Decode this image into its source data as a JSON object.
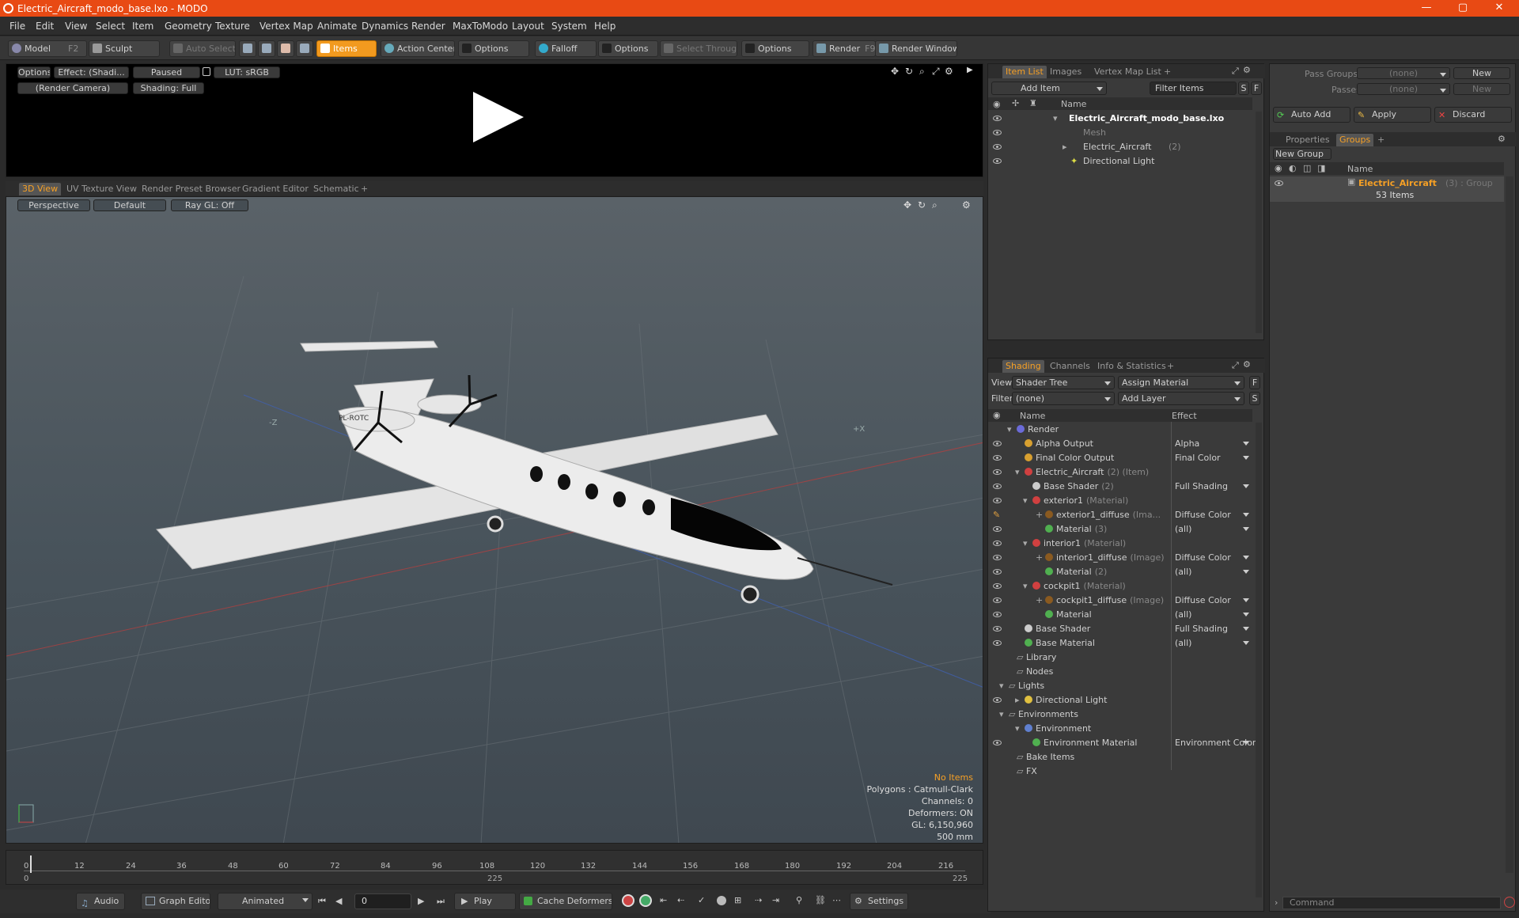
{
  "window": {
    "title": "Electric_Aircraft_modo_base.lxo - MODO",
    "controls": [
      "—",
      "▢",
      "✕"
    ]
  },
  "menu": [
    "File",
    "Edit",
    "View",
    "Select",
    "Item",
    "Geometry",
    "Texture",
    "Vertex Map",
    "Animate",
    "Dynamics",
    "Render",
    "MaxToModo",
    "Layout",
    "System",
    "Help"
  ],
  "toolbar": {
    "model": "Model",
    "model_key": "F2",
    "sculpt": "Sculpt",
    "auto_select": "Auto Select",
    "items": "Items",
    "action_center": "Action Center",
    "options1": "Options",
    "falloff": "Falloff",
    "options2": "Options",
    "select_through": "Select Through",
    "options3": "Options",
    "render": "Render",
    "render_key": "F9",
    "render_window": "Render Window"
  },
  "render_preview": {
    "options": "Options",
    "effect": "Effect: (Shadi...",
    "paused": "Paused",
    "lut": "LUT: sRGB",
    "camera": "(Render Camera)",
    "shading": "Shading: Full"
  },
  "view_tabs": [
    "3D View",
    "UV Texture View",
    "Render Preset Browser",
    "Gradient Editor",
    "Schematic",
    "+"
  ],
  "viewport": {
    "perspective": "Perspective",
    "default": "Default",
    "raygl": "Ray GL: Off",
    "info": {
      "items": "No Items",
      "polygons": "Polygons : Catmull-Clark",
      "channels": "Channels: 0",
      "deformers": "Deformers: ON",
      "gl": "GL: 6,150,960",
      "scale": "500 mm"
    },
    "axis_labels": {
      "neg_z": "-Z",
      "pos_x": "+X"
    },
    "tail_reg": "PL-ROTC"
  },
  "timeline": {
    "ticks": [
      "0",
      "12",
      "24",
      "36",
      "48",
      "60",
      "72",
      "84",
      "96",
      "108",
      "120",
      "132",
      "144",
      "156",
      "168",
      "180",
      "192",
      "204",
      "216"
    ],
    "start": "0",
    "mid": "225",
    "end": "225"
  },
  "bottom": {
    "audio": "Audio",
    "graph_editor": "Graph Editor",
    "animated": "Animated",
    "frame": "0",
    "play": "Play",
    "cache_deformers": "Cache Deformers",
    "settings": "Settings"
  },
  "item_list": {
    "tabs": [
      "Item List",
      "Images",
      "Vertex Map List",
      "+"
    ],
    "add_item": "Add Item",
    "filter": "Filter Items",
    "s": "S",
    "f": "F",
    "col_name": "Name",
    "rows": [
      {
        "label": "Electric_Aircraft_modo_base.lxo",
        "bold": true
      },
      {
        "label": "Mesh",
        "dim": true
      },
      {
        "label": "Electric_Aircraft",
        "suffix": "(2)"
      },
      {
        "label": "Directional Light"
      }
    ]
  },
  "shading": {
    "tabs": [
      "Shading",
      "Channels",
      "Info & Statistics",
      "+"
    ],
    "view_label": "View",
    "view_value": "Shader Tree",
    "assign_material": "Assign Material",
    "filter_label": "Filter",
    "filter_value": "(none)",
    "add_layer": "Add Layer",
    "f": "F",
    "s": "S",
    "col_name": "Name",
    "col_effect": "Effect",
    "rows": [
      {
        "label": "Render",
        "suffix": "",
        "effect": "",
        "color": "#6b6bd8"
      },
      {
        "label": "Alpha Output",
        "suffix": "",
        "effect": "Alpha",
        "color": "#d8a030"
      },
      {
        "label": "Final Color Output",
        "suffix": "",
        "effect": "Final Color",
        "color": "#d8a030"
      },
      {
        "label": "Electric_Aircraft",
        "suffix": "(2) (Item)",
        "effect": "",
        "color": "#d04040"
      },
      {
        "label": "Base Shader",
        "suffix": "(2)",
        "effect": "Full Shading",
        "color": "#cccccc"
      },
      {
        "label": "exterior1",
        "suffix": "(Material)",
        "effect": "",
        "color": "#d04040"
      },
      {
        "label": "exterior1_diffuse",
        "suffix": "(Ima...",
        "effect": "Diffuse Color",
        "color": "#8a5a20"
      },
      {
        "label": "Material",
        "suffix": "(3)",
        "effect": "(all)",
        "color": "#50b050"
      },
      {
        "label": "interior1",
        "suffix": "(Material)",
        "effect": "",
        "color": "#d04040"
      },
      {
        "label": "interior1_diffuse",
        "suffix": "(Image)",
        "effect": "Diffuse Color",
        "color": "#8a5a20"
      },
      {
        "label": "Material",
        "suffix": "(2)",
        "effect": "(all)",
        "color": "#50b050"
      },
      {
        "label": "cockpit1",
        "suffix": "(Material)",
        "effect": "",
        "color": "#d04040"
      },
      {
        "label": "cockpit1_diffuse",
        "suffix": "(Image)",
        "effect": "Diffuse Color",
        "color": "#8a5a20"
      },
      {
        "label": "Material",
        "suffix": "",
        "effect": "(all)",
        "color": "#50b050"
      },
      {
        "label": "Base Shader",
        "suffix": "",
        "effect": "Full Shading",
        "color": "#cccccc"
      },
      {
        "label": "Base Material",
        "suffix": "",
        "effect": "(all)",
        "color": "#50b050"
      },
      {
        "label": "Library",
        "suffix": "",
        "effect": "",
        "color": ""
      },
      {
        "label": "Nodes",
        "suffix": "",
        "effect": "",
        "color": ""
      },
      {
        "label": "Lights",
        "suffix": "",
        "effect": "",
        "color": ""
      },
      {
        "label": "Directional Light",
        "suffix": "",
        "effect": "",
        "color": "#e0c040"
      },
      {
        "label": "Environments",
        "suffix": "",
        "effect": "",
        "color": ""
      },
      {
        "label": "Environment",
        "suffix": "",
        "effect": "",
        "color": "#6080d0"
      },
      {
        "label": "Environment Material",
        "suffix": "",
        "effect": "Environment Color",
        "color": "#50b050"
      },
      {
        "label": "Bake Items",
        "suffix": "",
        "effect": "",
        "color": ""
      },
      {
        "label": "FX",
        "suffix": "",
        "effect": "",
        "color": ""
      }
    ]
  },
  "right_panel": {
    "pass_groups_label": "Pass Groups",
    "pass_groups_value": "(none)",
    "passes_label": "Passes",
    "passes_value": "(none)",
    "new1": "New",
    "new2": "New",
    "auto_add": "Auto Add",
    "apply": "Apply",
    "discard": "Discard",
    "tabs": [
      "Properties",
      "Groups",
      "+"
    ],
    "new_group": "New Group",
    "col_name": "Name",
    "group_name": "Electric_Aircraft",
    "group_suffix": "(3) : Group",
    "group_count": "53 Items",
    "command_placeholder": "Command"
  }
}
